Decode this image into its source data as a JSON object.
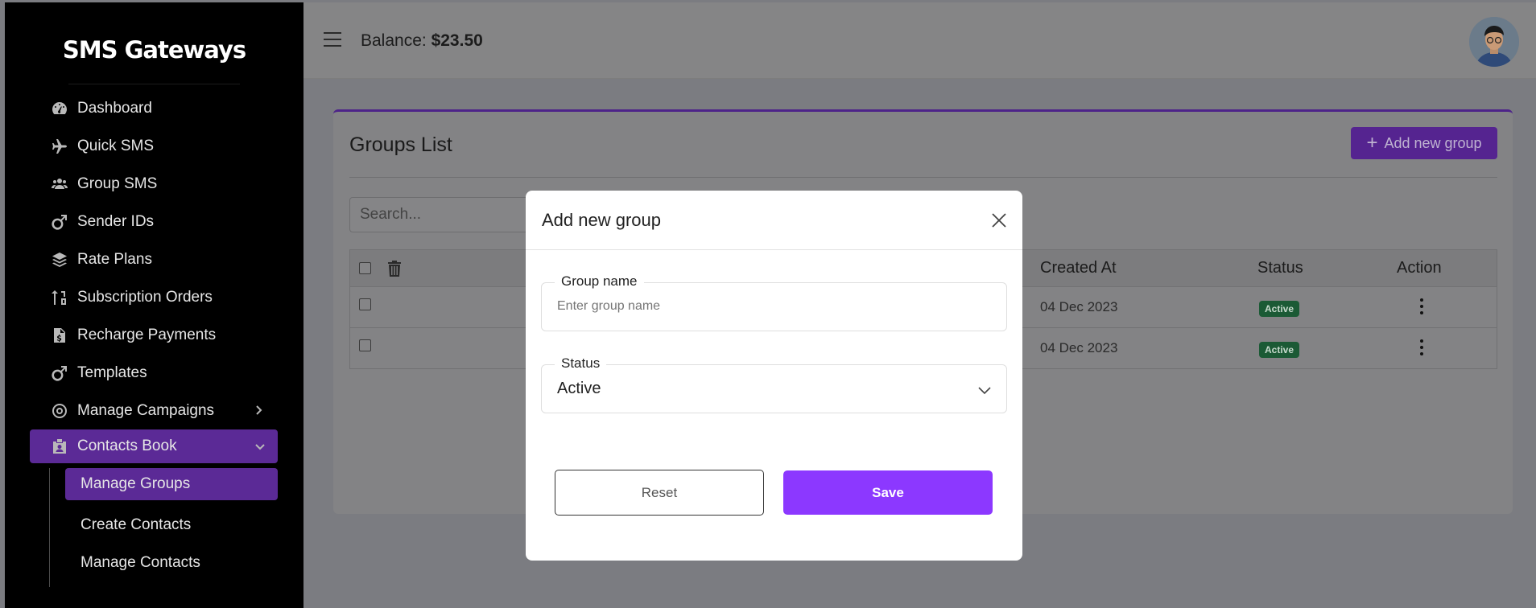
{
  "sidebar": {
    "brand": "SMS Gateways",
    "items": [
      {
        "label": "Dashboard",
        "icon": "dashboard-icon"
      },
      {
        "label": "Quick SMS",
        "icon": "plane-icon"
      },
      {
        "label": "Group SMS",
        "icon": "users-icon"
      },
      {
        "label": "Sender IDs",
        "icon": "mars-icon"
      },
      {
        "label": "Rate Plans",
        "icon": "layers-icon"
      },
      {
        "label": "Subscription Orders",
        "icon": "sort-icon"
      },
      {
        "label": "Recharge Payments",
        "icon": "invoice-icon"
      },
      {
        "label": "Templates",
        "icon": "mars-icon"
      },
      {
        "label": "Manage Campaigns",
        "icon": "bullseye-icon"
      },
      {
        "label": "Contacts Book",
        "icon": "id-badge-icon"
      }
    ],
    "subitems": [
      {
        "label": "Manage Groups"
      },
      {
        "label": "Create Contacts"
      },
      {
        "label": "Manage Contacts"
      }
    ]
  },
  "topbar": {
    "balance_label": "Balance:",
    "balance_value": "$23.50"
  },
  "card": {
    "title": "Groups List",
    "add_button": "Add new group",
    "search_placeholder": "Search...",
    "columns": {
      "created": "Created At",
      "status": "Status",
      "action": "Action"
    },
    "rows": [
      {
        "created": "04 Dec 2023",
        "status": "Active"
      },
      {
        "created": "04 Dec 2023",
        "status": "Active"
      }
    ]
  },
  "modal": {
    "title": "Add new group",
    "group_name_label": "Group name",
    "group_name_placeholder": "Enter group name",
    "status_label": "Status",
    "status_value": "Active",
    "reset_label": "Reset",
    "save_label": "Save"
  },
  "colors": {
    "accent": "#8c38ff",
    "active_badge": "#1b5a35",
    "sidebar_bg": "#000000"
  }
}
